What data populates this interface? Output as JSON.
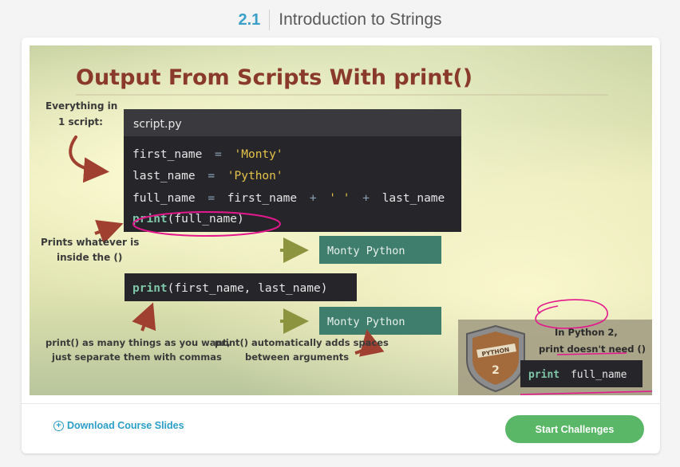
{
  "header": {
    "section_number": "2.1",
    "title": "Introduction to Strings"
  },
  "slide": {
    "title": "Output From Scripts With print()",
    "note_everything": [
      "Everything in",
      "1 script:"
    ],
    "note_prints": [
      "Prints whatever is",
      "inside the ()"
    ],
    "note_many": [
      "print() as many things as you want,",
      "just separate them with commas"
    ],
    "note_auto": [
      "print() automatically adds spaces",
      "between arguments"
    ],
    "editor": {
      "filename": "script.py",
      "line1": {
        "var": "first_name",
        "op": "=",
        "str": "'Monty'"
      },
      "line2": {
        "var": "last_name",
        "op": "=",
        "str": "'Python'"
      },
      "line3": {
        "var": "full_name",
        "op": "=",
        "a": "first_name",
        "plus1": "+",
        "str": "' '",
        "plus2": "+",
        "b": "last_name"
      },
      "line4": {
        "fn": "print",
        "args": "(full_name)"
      }
    },
    "output1": "Monty Python",
    "print2": {
      "fn": "print",
      "args": "(first_name, last_name)"
    },
    "output2": "Monty Python",
    "python2": {
      "badge_top": "PYTHON",
      "badge_num": "2",
      "line1": "In Python 2,",
      "line2": "print doesn't need ()",
      "code_kw": "print",
      "code_arg": "full_name"
    }
  },
  "footer": {
    "download_label": "Download Course Slides",
    "start_label": "Start Challenges"
  },
  "colors": {
    "accent_blue": "#2a9fc9",
    "button_green": "#5bb768",
    "slide_title": "#8a3a2a",
    "code_bg": "#26262a",
    "output_bg": "#3f7d6c",
    "annotation_magenta": "#e4178d"
  },
  "icons": [
    "download-circle-icon",
    "arrow-right-icon",
    "curved-arrow-icon",
    "python-shield-icon"
  ]
}
